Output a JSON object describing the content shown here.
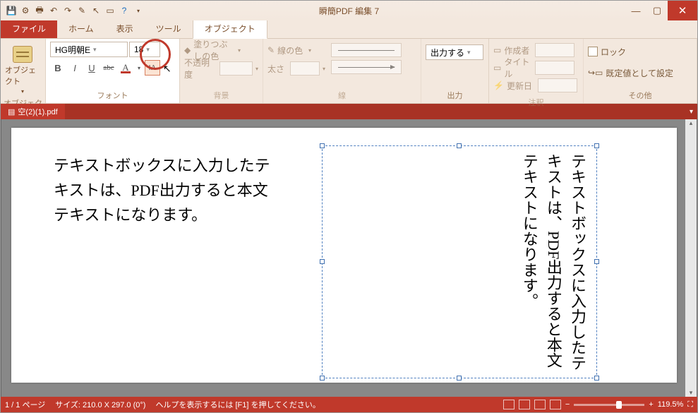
{
  "app_title": "瞬簡PDF 編集 7",
  "quick_access": [
    "save",
    "config",
    "print",
    "undo",
    "redo",
    "edit",
    "select",
    "view",
    "help"
  ],
  "tabs": {
    "file": "ファイル",
    "home": "ホーム",
    "view": "表示",
    "tool": "ツール",
    "object": "オブジェクト"
  },
  "ribbon": {
    "object_group": "オブジェクト",
    "object_button": "オブジェクト",
    "font_group": "フォント",
    "font_name": "HG明朝E",
    "font_size": "18",
    "bg_group": "背景",
    "fill_label": "塗りつぶしの色",
    "opacity_label": "不透明度",
    "line_group": "線",
    "line_color_label": "線の色",
    "line_width_label": "太さ",
    "output_group": "出力",
    "output_value": "出力する",
    "annot_group": "注釈",
    "author_label": "作成者",
    "title_label": "タイトル",
    "updated_label": "更新日",
    "other_group": "その他",
    "lock_label": "ロック",
    "default_label": "既定値として設定"
  },
  "doc_tab": "空(2)(1).pdf",
  "body_text": "テキストボックスに入力したテキストは、PDF出力すると本文テキストになります。",
  "vertical_text": "テキストボックスに入力したテキストは、PDF出力すると本文テキストになります。",
  "status": {
    "page": "1 / 1 ページ",
    "size": "サイズ: 210.0 X 297.0 (0°)",
    "help": "ヘルプを表示するには [F1] を押してください。",
    "zoom": "119.5%"
  }
}
